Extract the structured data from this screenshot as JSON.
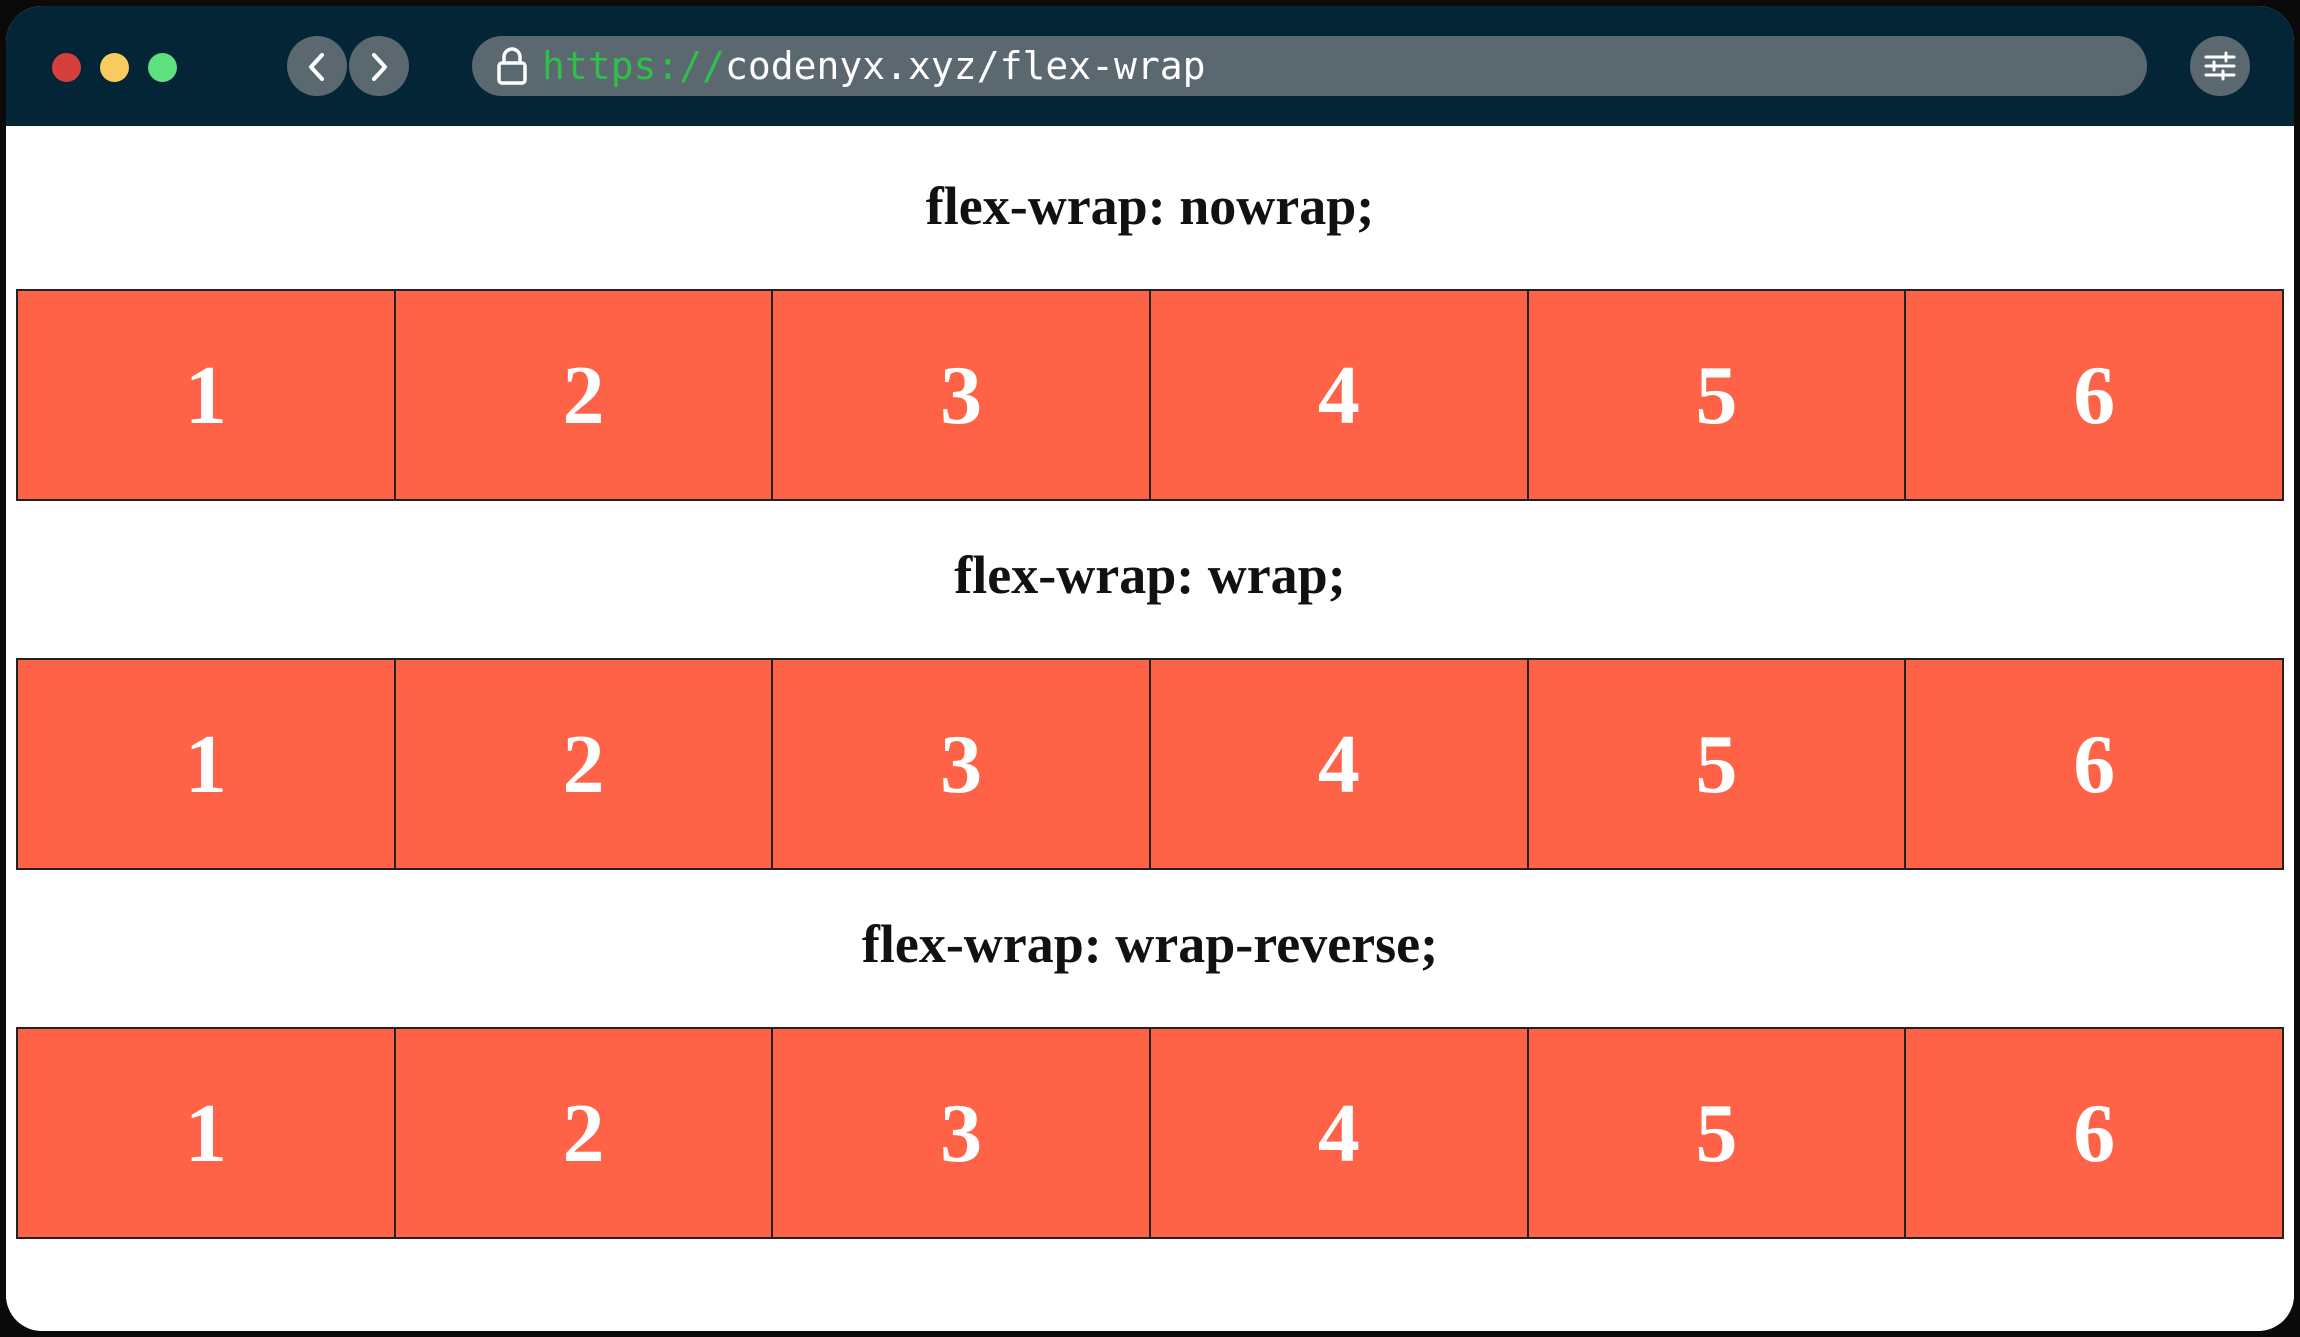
{
  "window": {
    "traffic_lights": {
      "close_color": "#d5403d",
      "minimize_color": "#f7cb5f",
      "zoom_color": "#5ee07f"
    }
  },
  "browser": {
    "url_scheme": "https://",
    "url_rest": "codenyx.xyz/flex-wrap",
    "icons": {
      "back": "chevron-left-icon",
      "forward": "chevron-right-icon",
      "lock": "lock-icon",
      "settings": "sliders-icon"
    }
  },
  "page": {
    "accent_color": "#ff6347",
    "sections": [
      {
        "heading": "flex-wrap: nowrap;",
        "items": [
          "1",
          "2",
          "3",
          "4",
          "5",
          "6"
        ]
      },
      {
        "heading": "flex-wrap: wrap;",
        "items": [
          "1",
          "2",
          "3",
          "4",
          "5",
          "6"
        ]
      },
      {
        "heading": "flex-wrap: wrap-reverse;",
        "items": [
          "1",
          "2",
          "3",
          "4",
          "5",
          "6"
        ]
      }
    ]
  }
}
